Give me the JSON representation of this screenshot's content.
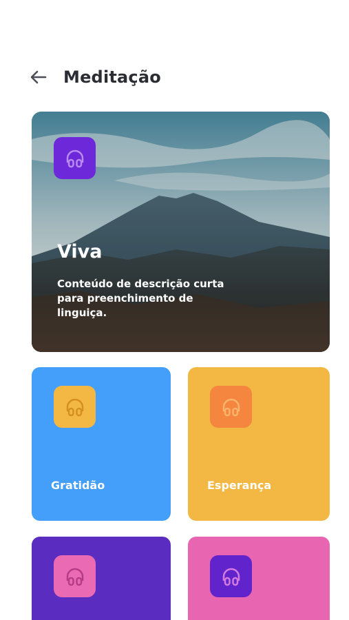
{
  "header": {
    "title": "Meditação",
    "back_icon": "arrow-left-icon"
  },
  "hero": {
    "title": "Viva",
    "description": "Conteúdo de descrição curta para preenchimento de linguiça.",
    "icon": "headphones-icon",
    "icon_bg": "#6d28d9"
  },
  "cards": [
    {
      "label": "Gratidão",
      "bg": "#449ffa",
      "icon": "headphones-icon",
      "icon_bg": "#f3b843",
      "icon_color": "#d58f1f"
    },
    {
      "label": "Esperança",
      "bg": "#f3b843",
      "icon": "headphones-icon",
      "icon_bg": "#f5863f",
      "icon_color": "#f7b46a"
    },
    {
      "label": "",
      "bg": "#5b2cc0",
      "icon": "headphones-icon",
      "icon_bg": "#ea6ab3",
      "icon_color": "#b53b86"
    },
    {
      "label": "",
      "bg": "#e866b1",
      "icon": "headphones-icon",
      "icon_bg": "#6124cc",
      "icon_color": "#d57be0"
    }
  ]
}
